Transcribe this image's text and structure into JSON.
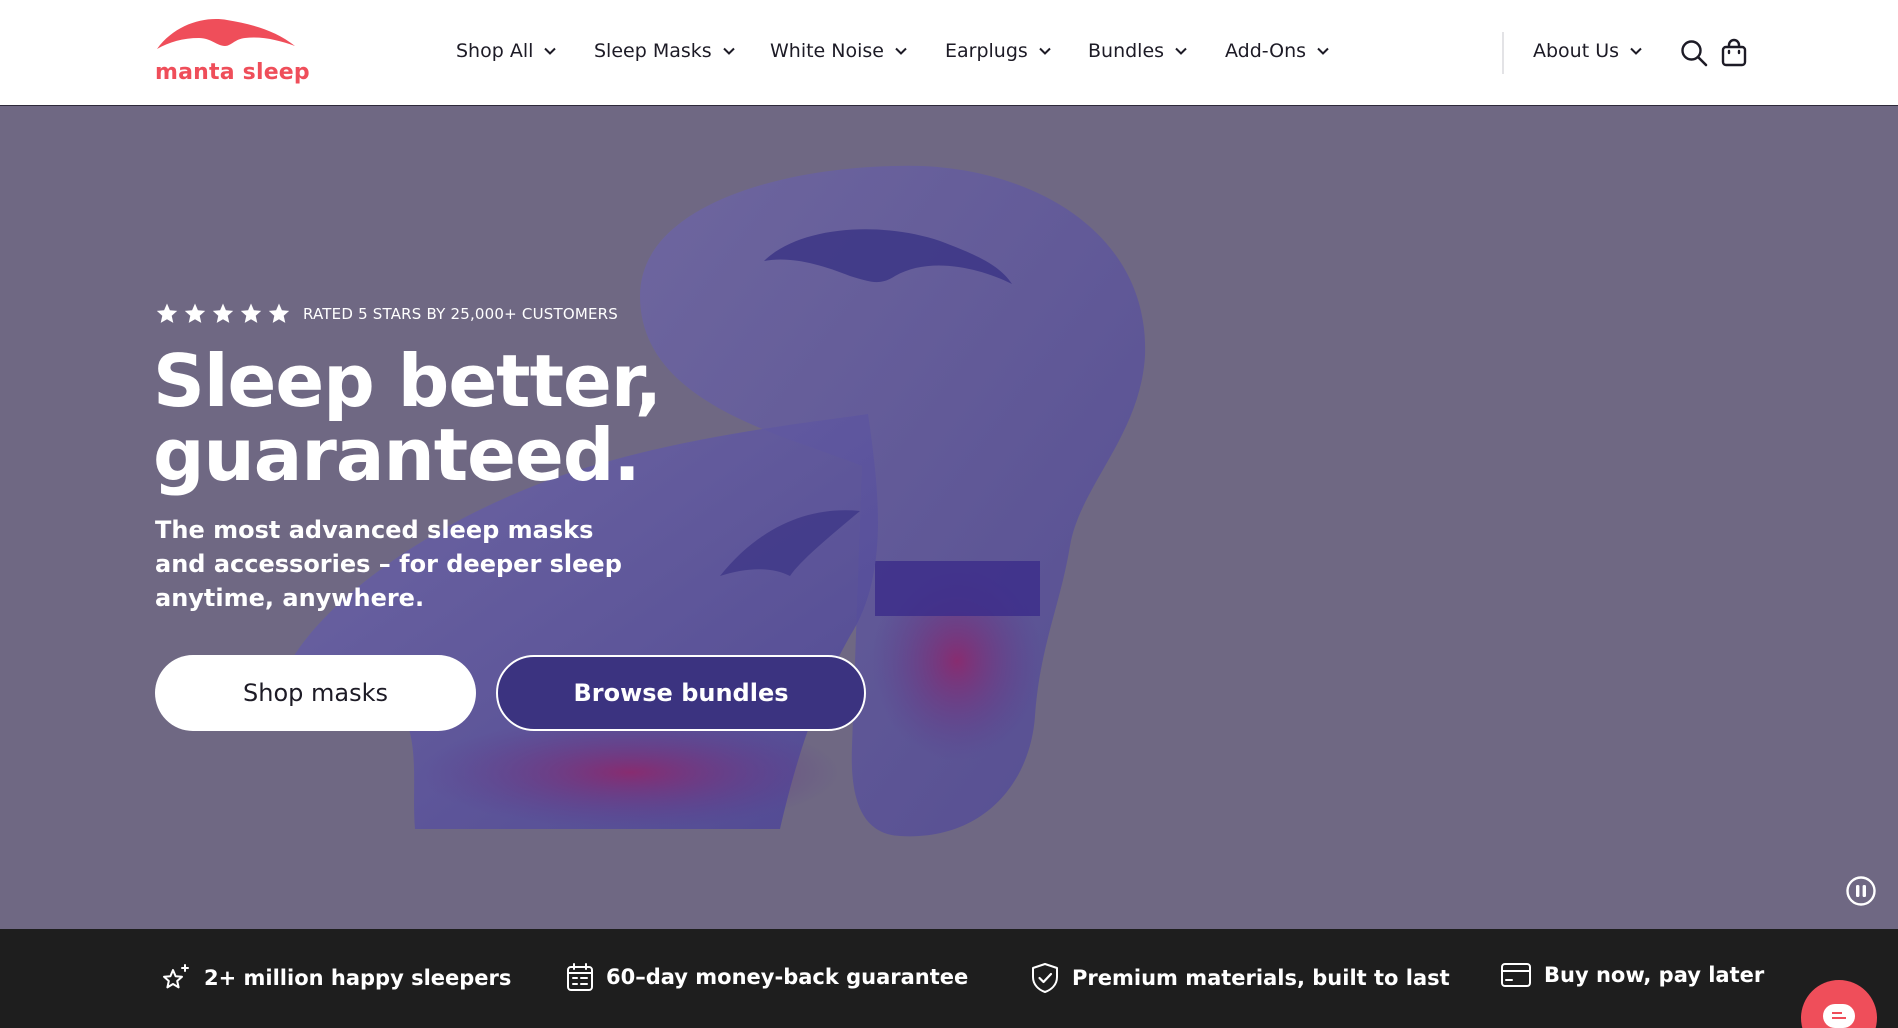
{
  "brand": {
    "name": "manta sleep",
    "color": "#ef4e5a",
    "logo_icon": "manta-wing-logo"
  },
  "nav": {
    "items": [
      {
        "label": "Shop All"
      },
      {
        "label": "Sleep Masks"
      },
      {
        "label": "White Noise"
      },
      {
        "label": "Earplugs"
      },
      {
        "label": "Bundles"
      },
      {
        "label": "Add-Ons"
      }
    ],
    "about_label": "About Us",
    "icons": [
      "search-icon",
      "shopping-bag-icon",
      "chevron-down-icon"
    ]
  },
  "hero": {
    "rating": {
      "stars": 5,
      "max": 5,
      "text": "RATED 5 STARS BY 25,000+ CUSTOMERS"
    },
    "title_line1": "Sleep better,",
    "title_line2": "guaranteed.",
    "subtitle": "The most advanced sleep masks and accessories – for deeper sleep anytime, anywhere.",
    "primary_button": "Shop masks",
    "secondary_button": "Browse bundles",
    "background_color": "#6f6883",
    "video_control": "pause-icon"
  },
  "trust_bar": {
    "items": [
      {
        "icon": "sparkle-star-icon",
        "label": "2+ million happy sleepers"
      },
      {
        "icon": "calendar-icon",
        "label": "60–day money-back guarantee"
      },
      {
        "icon": "shield-check-icon",
        "label": "Premium materials, built to last"
      },
      {
        "icon": "credit-card-icon",
        "label": "Buy now, pay later"
      }
    ]
  },
  "chat": {
    "icon": "chat-bubble-icon",
    "color": "#ef4e5a"
  }
}
